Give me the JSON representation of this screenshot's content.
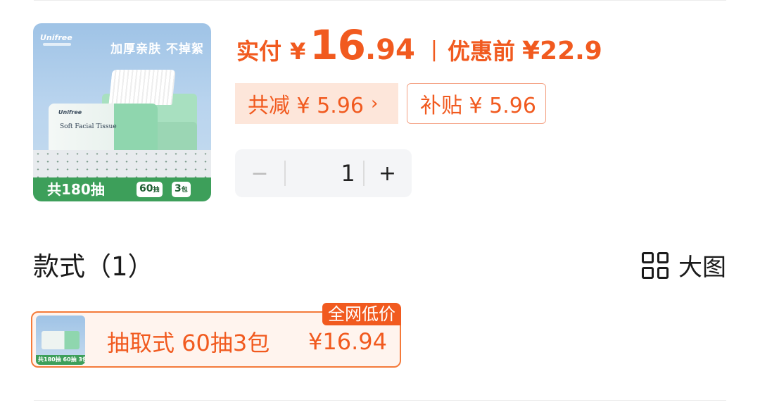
{
  "product": {
    "image": {
      "brand": "Unifree",
      "slogan": "加厚亲肤 不掉絮",
      "pack_name": "Soft Facial Tissue",
      "total_count": "共180抽",
      "tag_sheets_num": "60",
      "tag_sheets_unit": "抽",
      "tag_packs_num": "3",
      "tag_packs_unit": "包"
    }
  },
  "price": {
    "actual_label": "实付",
    "currency": "¥",
    "actual_int": "16",
    "actual_dec": ".94",
    "separator": "|",
    "before_label": "优惠前",
    "before_value": "¥22.9"
  },
  "discounts": {
    "reduce_label": "共减 ¥ 5.96",
    "reduce_arrow": "›",
    "subsidy_label": "补贴 ¥ 5.96"
  },
  "quantity": {
    "minus": "−",
    "value": "1",
    "plus": "+"
  },
  "styles": {
    "title": "款式（1）",
    "view_toggle_label": "大图",
    "variants": [
      {
        "name": "抽取式 60抽3包",
        "price": "¥16.94",
        "badge": "全网低价",
        "thumb_text": "共180抽 60抽 3包"
      }
    ]
  },
  "colors": {
    "accent": "#f15a1f",
    "accent_light": "#fde6da",
    "product_green": "#3d9f5a"
  }
}
